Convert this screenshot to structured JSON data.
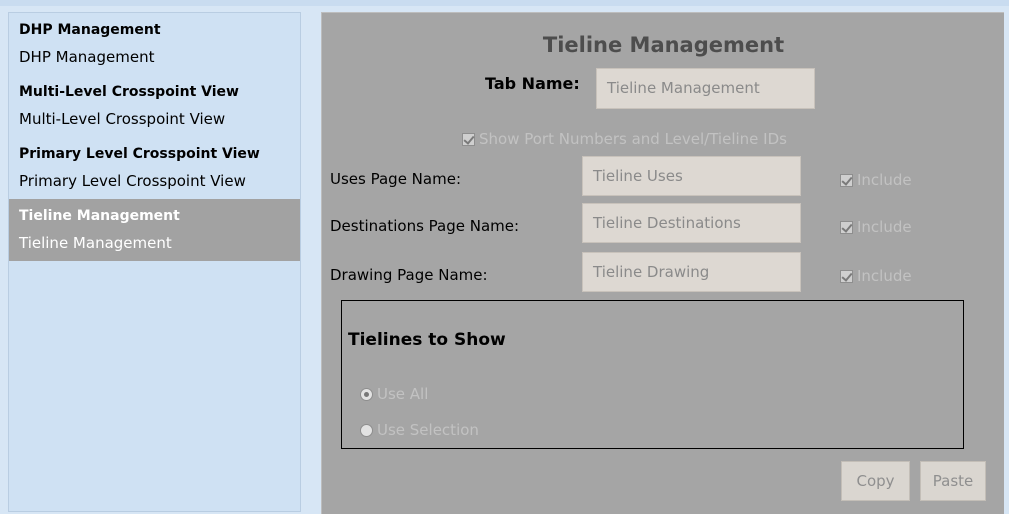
{
  "sidebar": {
    "items": [
      {
        "title": "DHP Management",
        "subtitle": "DHP Management",
        "active": false
      },
      {
        "title": "Multi-Level Crosspoint View",
        "subtitle": "Multi-Level Crosspoint View",
        "active": false
      },
      {
        "title": "Primary Level Crosspoint View",
        "subtitle": "Primary Level Crosspoint View",
        "active": false
      },
      {
        "title": "Tieline Management",
        "subtitle": "Tieline Management",
        "active": true
      }
    ]
  },
  "main": {
    "title": "Tieline Management",
    "tab_name_label": "Tab Name:",
    "tab_name_value": "Tieline Management",
    "show_port_label": "Show Port Numbers and Level/Tieline IDs",
    "rows": [
      {
        "label": "Uses Page Name:",
        "value": "Tieline Uses",
        "include_label": "Include"
      },
      {
        "label": "Destinations Page Name:",
        "value": "Tieline Destinations",
        "include_label": "Include"
      },
      {
        "label": "Drawing Page Name:",
        "value": "Tieline Drawing",
        "include_label": "Include"
      }
    ],
    "tielines_group": {
      "title": "Tielines to Show",
      "options": [
        {
          "label": "Use All",
          "selected": true
        },
        {
          "label": "Use Selection",
          "selected": false
        }
      ]
    },
    "copy_label": "Copy",
    "paste_label": "Paste"
  },
  "colors": {
    "sidebar_bg": "#cfe1f3",
    "active_item_bg": "#a2a2a2",
    "panel_bg": "#a5a5a5",
    "field_bg": "#ddd8d2",
    "disabled_text": "#c2c2c2"
  }
}
